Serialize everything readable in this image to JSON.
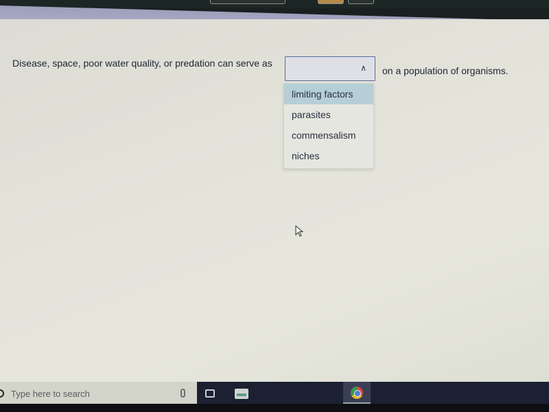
{
  "question": {
    "before_text": "Disease, space, poor water quality, or predation can serve as",
    "after_text": "on a population of organisms.",
    "dropdown": {
      "selected_value": "",
      "expanded": true,
      "chevron_icon": "chevron-up-icon",
      "options": [
        {
          "label": "limiting factors",
          "highlighted": true
        },
        {
          "label": "parasites",
          "highlighted": false
        },
        {
          "label": "commensalism",
          "highlighted": false
        },
        {
          "label": "niches",
          "highlighted": false
        }
      ]
    }
  },
  "taskbar": {
    "search_placeholder": "Type here to search",
    "icons": [
      "search-circle-icon",
      "microphone-icon",
      "task-view-icon",
      "file-explorer-icon",
      "chrome-icon"
    ]
  },
  "colors": {
    "highlight": "#b6cfd6",
    "dropdown_border": "#5a6b9a",
    "header_band": "#a7a8c3",
    "taskbar": "#1b2033"
  }
}
